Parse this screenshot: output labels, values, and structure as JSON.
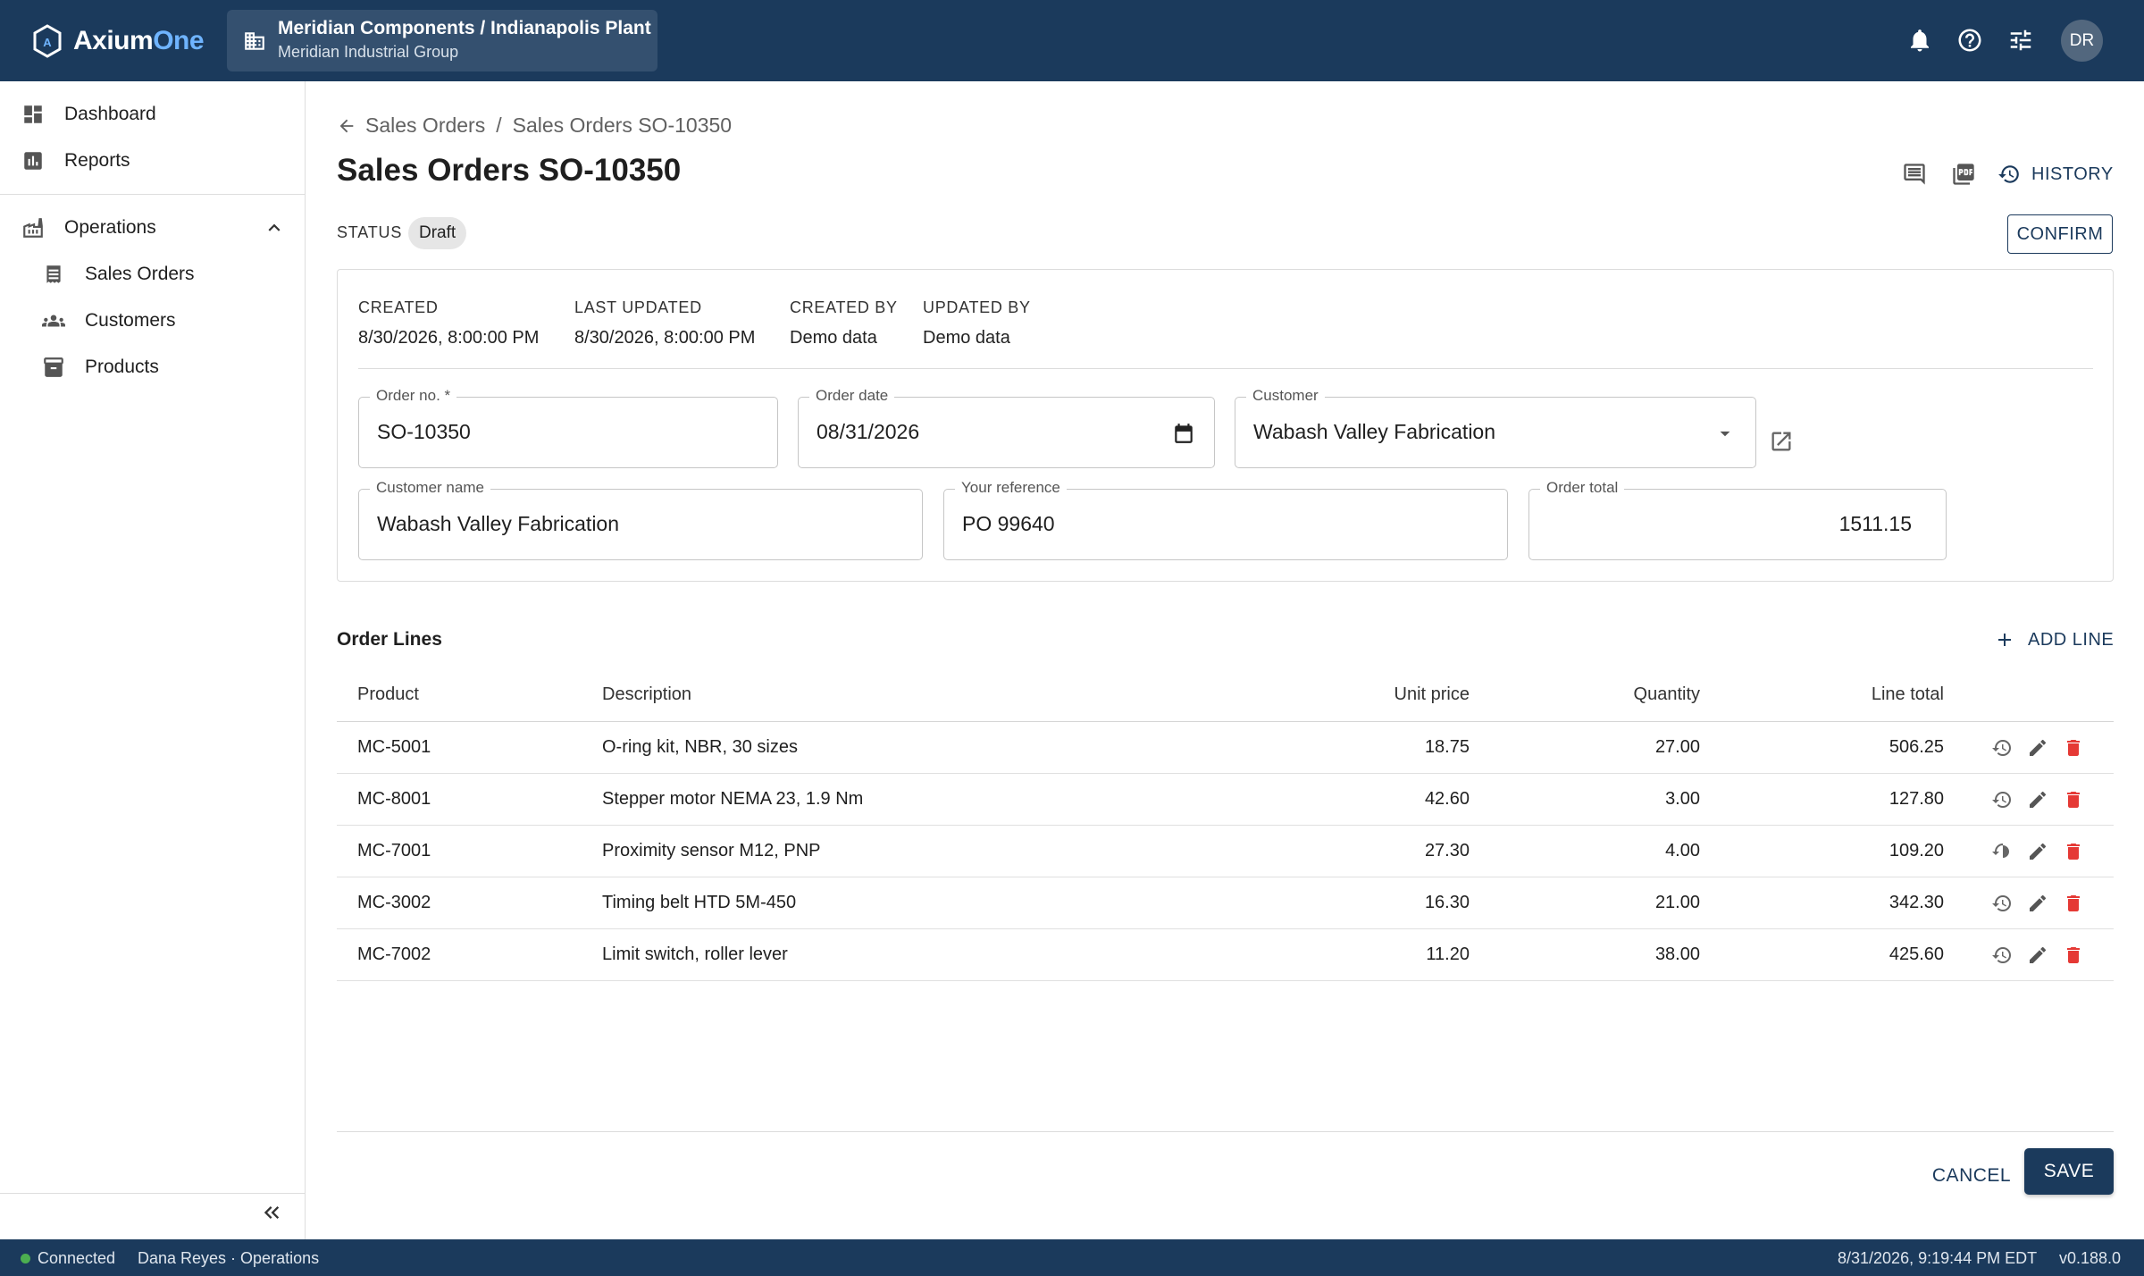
{
  "app": {
    "brand_main": "Axium",
    "brand_accent": "One",
    "org_title": "Meridian Components / Indianapolis Plant",
    "org_subtitle": "Meridian Industrial Group",
    "user_initials": "DR"
  },
  "colors": {
    "primary": "#1b3a5c",
    "accent": "#6fb4ff",
    "danger": "#e53935",
    "connected": "#4caf50"
  },
  "sidebar": {
    "items": [
      {
        "label": "Dashboard",
        "icon": "dashboard-icon"
      },
      {
        "label": "Reports",
        "icon": "bar-chart-icon"
      },
      {
        "label": "Operations",
        "icon": "factory-icon",
        "expanded": true
      },
      {
        "label": "Sales Orders",
        "icon": "receipt-icon"
      },
      {
        "label": "Customers",
        "icon": "group-icon"
      },
      {
        "label": "Products",
        "icon": "archive-box-icon"
      }
    ]
  },
  "page": {
    "breadcrumb_root": "Sales Orders",
    "breadcrumb_sep": "/",
    "breadcrumb_current": "Sales Orders SO-10350",
    "title": "Sales Orders SO-10350",
    "history_label": "HISTORY",
    "status_label": "STATUS",
    "status_value": "Draft",
    "confirm_label": "CONFIRM"
  },
  "meta": {
    "created_label": "CREATED",
    "created_value": "8/30/2026, 8:00:00 PM",
    "updated_label": "LAST UPDATED",
    "updated_value": "8/30/2026, 8:00:00 PM",
    "created_by_label": "CREATED BY",
    "created_by_value": "Demo data",
    "updated_by_label": "UPDATED BY",
    "updated_by_value": "Demo data"
  },
  "form": {
    "order_no_label": "Order no. *",
    "order_no_value": "SO-10350",
    "order_date_label": "Order date",
    "order_date_value": "08/31/2026",
    "customer_label": "Customer",
    "customer_value": "Wabash Valley Fabrication",
    "customer_name_label": "Customer name",
    "customer_name_value": "Wabash Valley Fabrication",
    "reference_label": "Your reference",
    "reference_value": "PO 99640",
    "order_total_label": "Order total",
    "order_total_value": "1511.15"
  },
  "lines": {
    "title": "Order Lines",
    "add_label": "ADD LINE",
    "columns": {
      "product": "Product",
      "description": "Description",
      "unit_price": "Unit price",
      "quantity": "Quantity",
      "line_total": "Line total"
    },
    "rows": [
      {
        "product": "MC-5001",
        "description": "O-ring kit, NBR, 30 sizes",
        "unit_price": "18.75",
        "quantity": "27.00",
        "line_total": "506.25"
      },
      {
        "product": "MC-8001",
        "description": "Stepper motor NEMA 23, 1.9 Nm",
        "unit_price": "42.60",
        "quantity": "3.00",
        "line_total": "127.80"
      },
      {
        "product": "MC-7001",
        "description": "Proximity sensor M12, PNP",
        "unit_price": "27.30",
        "quantity": "4.00",
        "line_total": "109.20"
      },
      {
        "product": "MC-3002",
        "description": "Timing belt HTD 5M-450",
        "unit_price": "16.30",
        "quantity": "21.00",
        "line_total": "342.30"
      },
      {
        "product": "MC-7002",
        "description": "Limit switch, roller lever",
        "unit_price": "11.20",
        "quantity": "38.00",
        "line_total": "425.60"
      }
    ]
  },
  "actions": {
    "cancel_label": "CANCEL",
    "save_label": "SAVE"
  },
  "statusbar": {
    "connection": "Connected",
    "user": "Dana Reyes · Operations",
    "datetime": "8/31/2026, 9:19:44 PM EDT",
    "version": "v0.188.0"
  }
}
